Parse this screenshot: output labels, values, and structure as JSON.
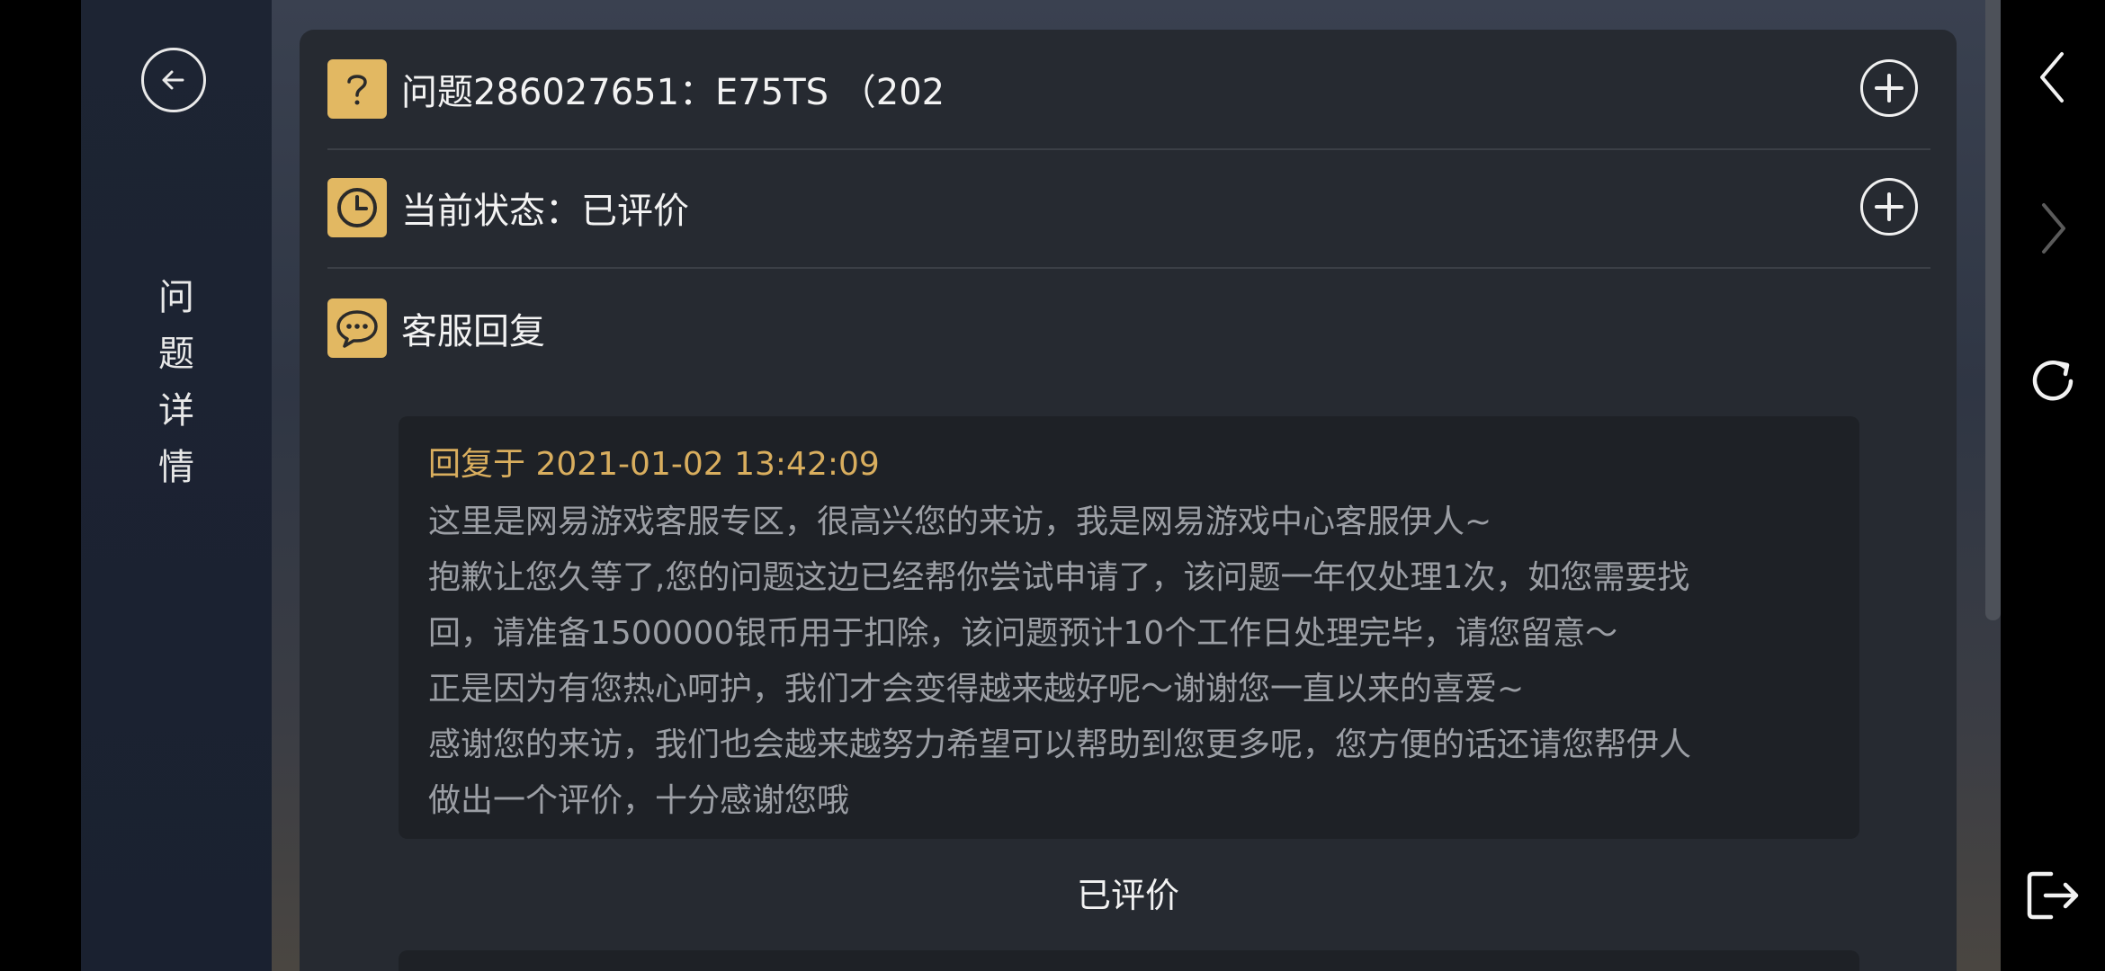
{
  "side": {
    "title_chars": [
      "问",
      "题",
      "详",
      "情"
    ]
  },
  "question": {
    "text": "问题286027651：E75TS （202"
  },
  "status": {
    "text": "当前状态：已评价"
  },
  "service_reply": {
    "header": "客服回复",
    "time": "回复于 2021-01-02 13:42:09",
    "lines": [
      "这里是网易游戏客服专区，很高兴您的来访，我是网易游戏中心客服伊人~",
      "抱歉让您久等了,您的问题这边已经帮你尝试申请了，该问题一年仅处理1次，如您需要找",
      "回，请准备1500000银币用于扣除，该问题预计10个工作日处理完毕，请您留意～",
      "正是因为有您热心呵护，我们才会变得越来越好呢～谢谢您一直以来的喜爱~",
      "感谢您的来访，我们也会越来越努力希望可以帮助到您更多呢，您方便的话还请您帮伊人",
      "做出一个评价，十分感谢您哦"
    ],
    "rating_status": "已评价"
  },
  "icons": {
    "back": "arrow-left-circle-icon",
    "question": "question-mark-icon",
    "status": "clock-icon",
    "reply": "chat-bubble-icon",
    "expand": "plus-circle-icon",
    "nav_back": "chevron-left-icon",
    "nav_forward": "chevron-right-icon",
    "nav_refresh": "refresh-icon",
    "nav_exit": "exit-icon"
  },
  "colors": {
    "accent_gold": "#e2b862",
    "reply_time": "#d9ae5e",
    "card_bg": "#262a31",
    "side_bg": "#1d2433"
  }
}
